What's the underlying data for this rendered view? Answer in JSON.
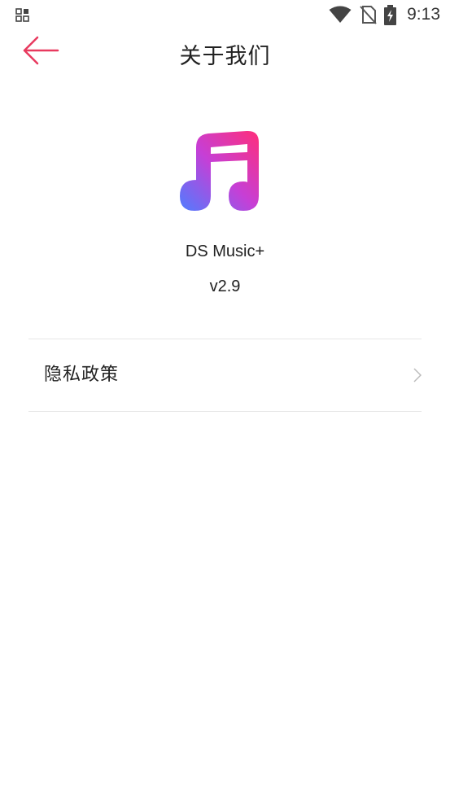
{
  "status_bar": {
    "time": "9:13",
    "icons": [
      "notification-grid-icon",
      "wifi-icon",
      "no-sim-icon",
      "battery-charging-icon"
    ]
  },
  "header": {
    "title": "关于我们",
    "back_icon": "arrow-left-icon"
  },
  "app": {
    "name": "DS Music+",
    "version": "v2.9",
    "logo_icon": "music-note-logo"
  },
  "menu": {
    "items": [
      {
        "label": "隐私政策",
        "icon": "chevron-right-icon"
      }
    ]
  },
  "colors": {
    "accent": "#e83a5f",
    "background": "#ffffff",
    "text": "#222222",
    "divider": "#e6e6e6",
    "logo_gradient": [
      "#ff2e7a",
      "#b44af0",
      "#4f7dff"
    ]
  }
}
